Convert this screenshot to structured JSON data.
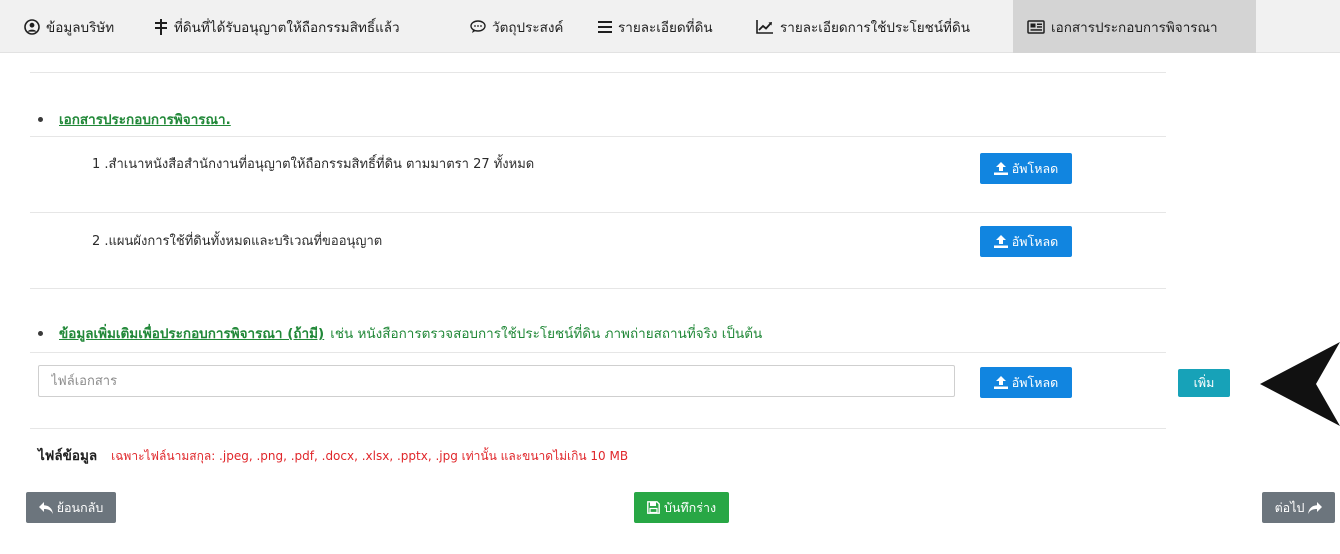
{
  "tabs": [
    {
      "label": "ข้อมูลบริษัท",
      "icon": "user-circle-icon"
    },
    {
      "label": "ที่ดินที่ได้รับอนุญาตให้ถือกรรมสิทธิ์แล้ว",
      "icon": "land-marker-icon"
    },
    {
      "label": "วัตถุประสงค์",
      "icon": "chat-bubble-icon"
    },
    {
      "label": "รายละเอียดที่ดิน",
      "icon": "list-lines-icon"
    },
    {
      "label": "รายละเอียดการใช้ประโยชน์ที่ดิน",
      "icon": "line-chart-icon"
    },
    {
      "label": "เอกสารประกอบการพิจารณา",
      "icon": "document-card-icon",
      "active": true
    }
  ],
  "section_docs": {
    "title": "เอกสารประกอบการพิจารณา.",
    "items": [
      {
        "label": "1 .สำเนาหนังสือสำนักงานที่อนุญาตให้ถือกรรมสิทธิ์ที่ดิน ตามมาตรา 27 ทั้งหมด",
        "upload_label": "อัพโหลด"
      },
      {
        "label": "2 .แผนผังการใช้ที่ดินทั้งหมดและบริเวณที่ขออนุญาต",
        "upload_label": "อัพโหลด"
      }
    ]
  },
  "section_extra": {
    "title": "ข้อมูลเพิ่มเติมเพื่อประกอบการพิจารณา (ถ้ามี)",
    "note": "เช่น หนังสือการตรวจสอบการใช้ประโยชน์ที่ดิน ภาพถ่ายสถานที่จริง เป็นต้น",
    "file_placeholder": "ไฟล์เอกสาร",
    "upload_label": "อัพโหลด",
    "add_label": "เพิ่ม"
  },
  "file_info": {
    "label": "ไฟล์ข้อมูล",
    "note": "เฉพาะไฟล์นามสกุล: .jpeg, .png, .pdf, .docx, .xlsx, .pptx, .jpg เท่านั้น และขนาดไม่เกิน 10 MB"
  },
  "footer": {
    "back_label": "ย้อนกลับ",
    "save_label": "บันทึกร่าง",
    "next_label": "ต่อไป"
  },
  "colors": {
    "tab_bg": "#f1f1f1",
    "tab_active": "#d4d4d4",
    "link_green": "#218838",
    "upload_blue": "#1185e0",
    "add_teal": "#17a2b8",
    "save_green": "#28a745",
    "nav_gray": "#6c757d",
    "warning_red": "#e0262a"
  }
}
